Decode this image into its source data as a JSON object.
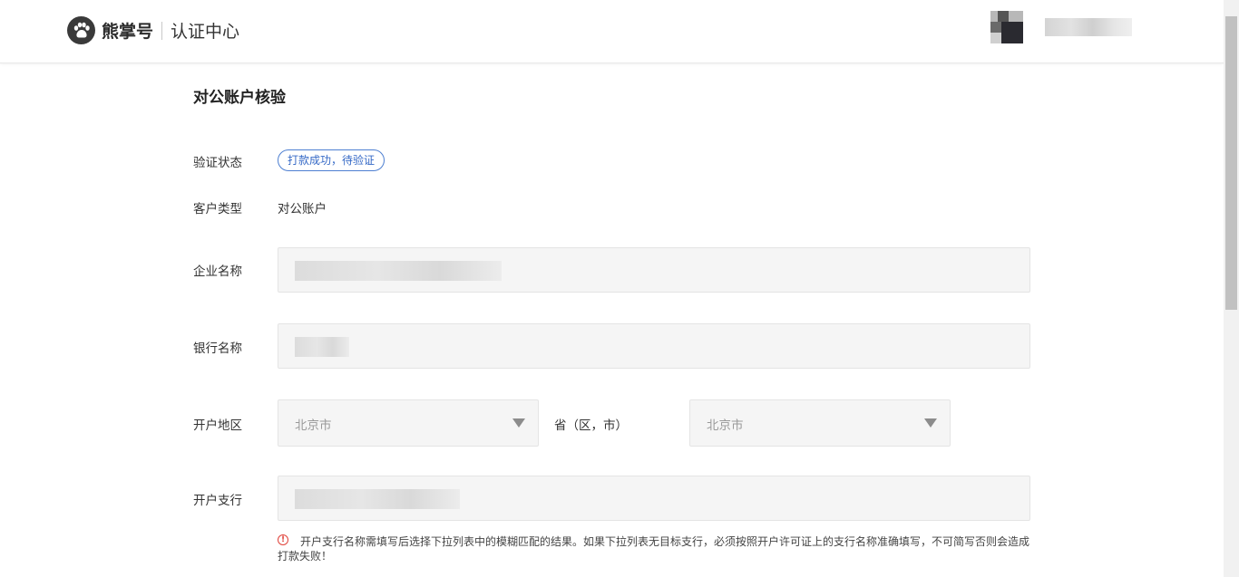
{
  "header": {
    "brand": "熊掌号",
    "subtitle": "认证中心",
    "brand_logo_icon": "paw-icon"
  },
  "page": {
    "title": "对公账户核验"
  },
  "form": {
    "status": {
      "label": "验证状态",
      "value": "打款成功，待验证",
      "accent": "#3569c6"
    },
    "customer_type": {
      "label": "客户类型",
      "value": "对公账户"
    },
    "company_name": {
      "label": "企业名称"
    },
    "bank_name": {
      "label": "银行名称"
    },
    "region": {
      "label": "开户地区",
      "province": "北京市",
      "middle": "省（区，市）",
      "city": "北京市"
    },
    "branch": {
      "label": "开户支行",
      "hint": "开户支行名称需填写后选择下拉列表中的模糊匹配的结果。如果下拉列表无目标支行，必须按照开户许可证上的支行名称准确填写，不可简写否则会造成打款失败！",
      "hint_icon": "alert-circle-icon",
      "hint_color": "#e0433b"
    }
  }
}
